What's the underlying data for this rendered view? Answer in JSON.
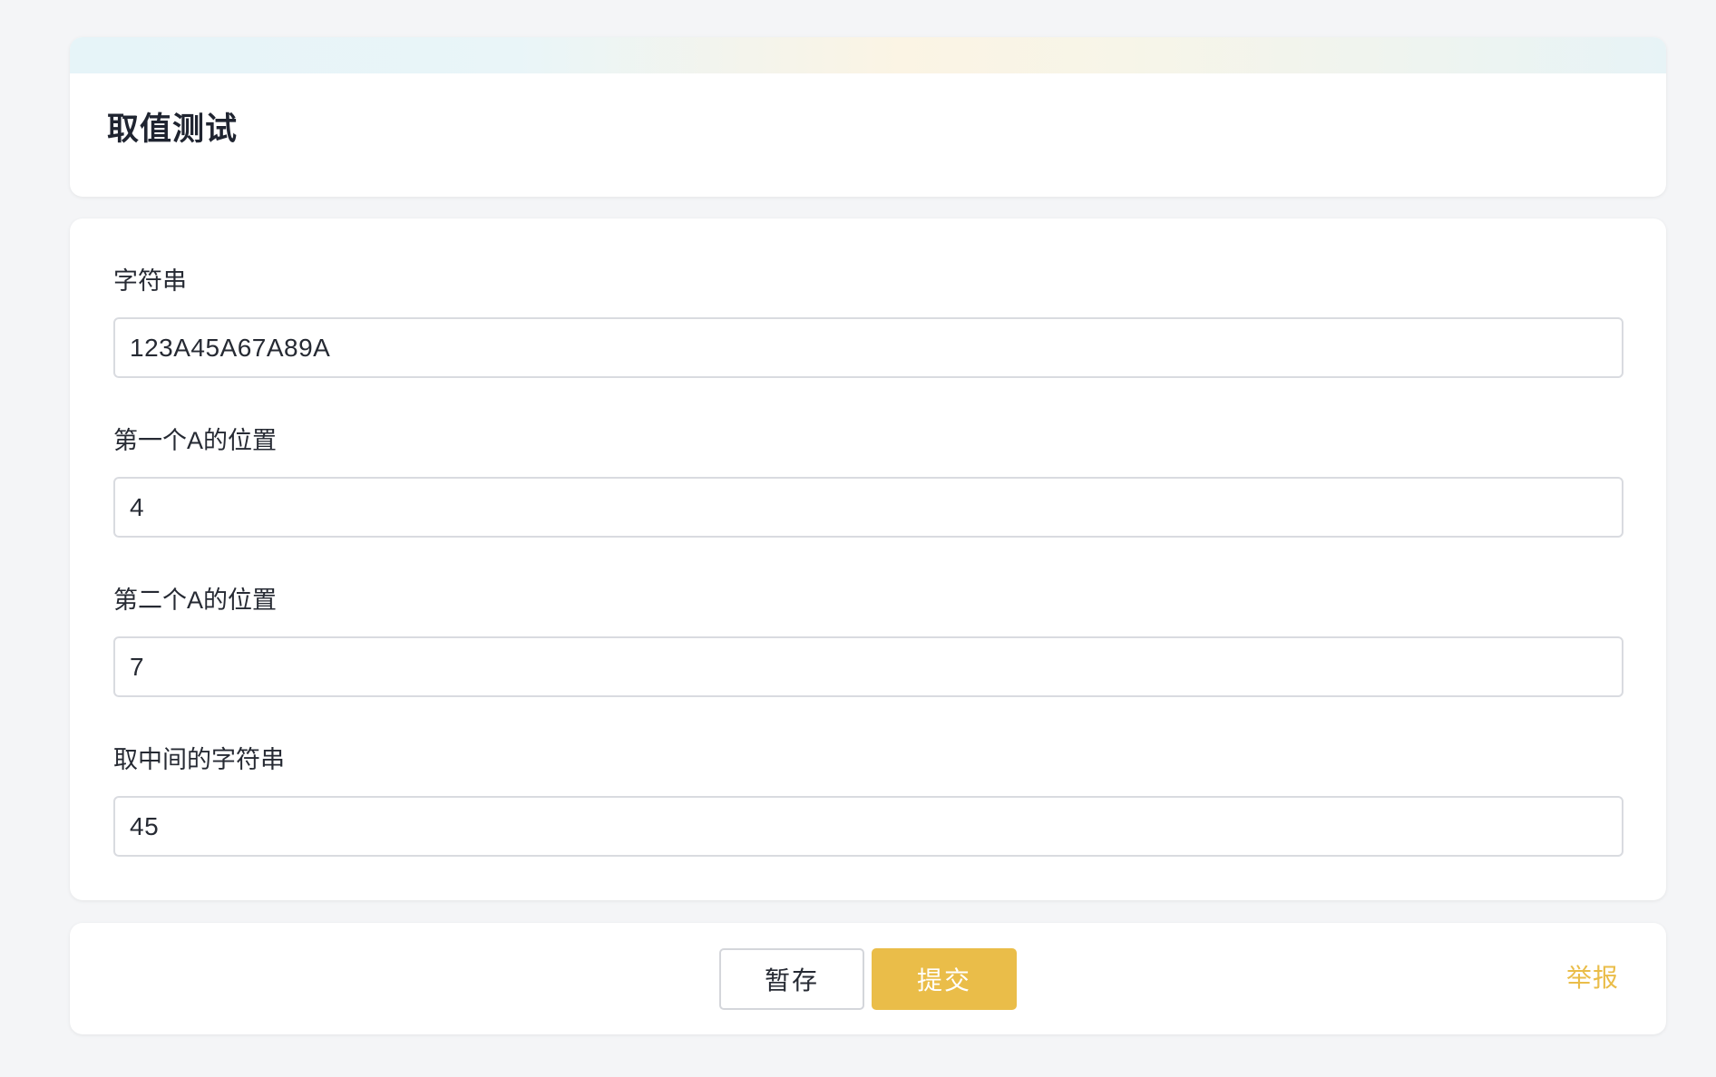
{
  "header": {
    "title": "取值测试"
  },
  "form": {
    "fields": [
      {
        "label": "字符串",
        "value": "123A45A67A89A"
      },
      {
        "label": "第一个A的位置",
        "value": "4"
      },
      {
        "label": "第二个A的位置",
        "value": "7"
      },
      {
        "label": "取中间的字符串",
        "value": "45"
      }
    ]
  },
  "actions": {
    "save_label": "暂存",
    "submit_label": "提交",
    "report_label": "举报"
  },
  "colors": {
    "accent": "#eabd49",
    "background": "#f4f5f7",
    "card": "#ffffff",
    "border": "#d9dbe0"
  }
}
